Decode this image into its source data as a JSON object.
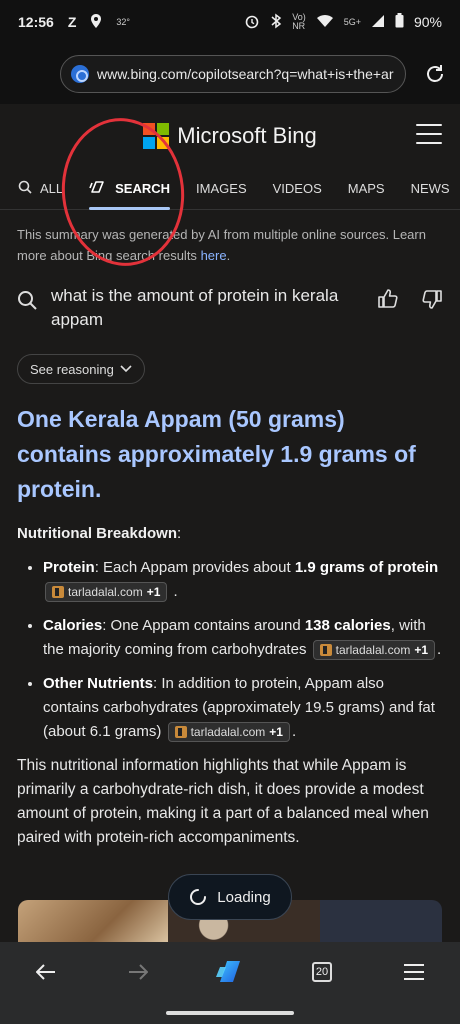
{
  "status_bar": {
    "time": "12:56",
    "app_letter": "Z",
    "temperature": "32°",
    "net_label": "Vo)\nNR",
    "signal_label": "5G+",
    "battery": "90%"
  },
  "browser": {
    "url": "www.bing.com/copilotsearch?q=what+is+the+ar"
  },
  "header": {
    "brand": "Microsoft Bing",
    "logo_colors": [
      "#f25022",
      "#7fba00",
      "#00a4ef",
      "#ffb900"
    ]
  },
  "tabs": [
    {
      "label": "ALL",
      "icon": "search-icon"
    },
    {
      "label": "SEARCH",
      "icon": "copilot-icon",
      "active": true
    },
    {
      "label": "IMAGES"
    },
    {
      "label": "VIDEOS"
    },
    {
      "label": "MAPS"
    },
    {
      "label": "NEWS"
    }
  ],
  "disclaimer": {
    "text": "This summary was generated by AI from multiple online sources. Learn more about Bing search results",
    "link": "here",
    "end": "."
  },
  "query": "what is the amount of protein in kerala appam",
  "reasoning_label": "See reasoning",
  "answer": {
    "headline": "One Kerala Appam (50 grams) contains approximately 1.9 grams of protein.",
    "section_title": "Nutritional Breakdown",
    "section_colon": ":",
    "items": [
      {
        "label": "Protein",
        "pre": ": Each Appam provides about ",
        "bold": "1.9 grams of protein",
        "post": "",
        "cite": "tarladalal.com",
        "cite_more": "+1"
      },
      {
        "label": "Calories",
        "pre": ": One Appam contains around ",
        "bold": "138 calories",
        "post": ", with the majority coming from carbohydrates",
        "cite": "tarladalal.com",
        "cite_more": "+1"
      },
      {
        "label": "Other Nutrients",
        "pre": ": In addition to protein, Appam also contains carbohydrates (approximately 19.5 grams) and fat (about 6.1 grams)",
        "bold": "",
        "post": "",
        "cite": "tarladalal.com",
        "cite_more": "+1"
      }
    ],
    "summary": "This nutritional information highlights that while Appam is primarily a carbohydrate-rich dish, it does provide a modest amount of protein, making it a part of a balanced meal when paired with protein-rich accompaniments."
  },
  "loading_label": "Loading",
  "bottom_nav": {
    "tab_count": "20"
  },
  "colors": {
    "accent": "#a9c7ff",
    "annotation": "#e3323a"
  }
}
